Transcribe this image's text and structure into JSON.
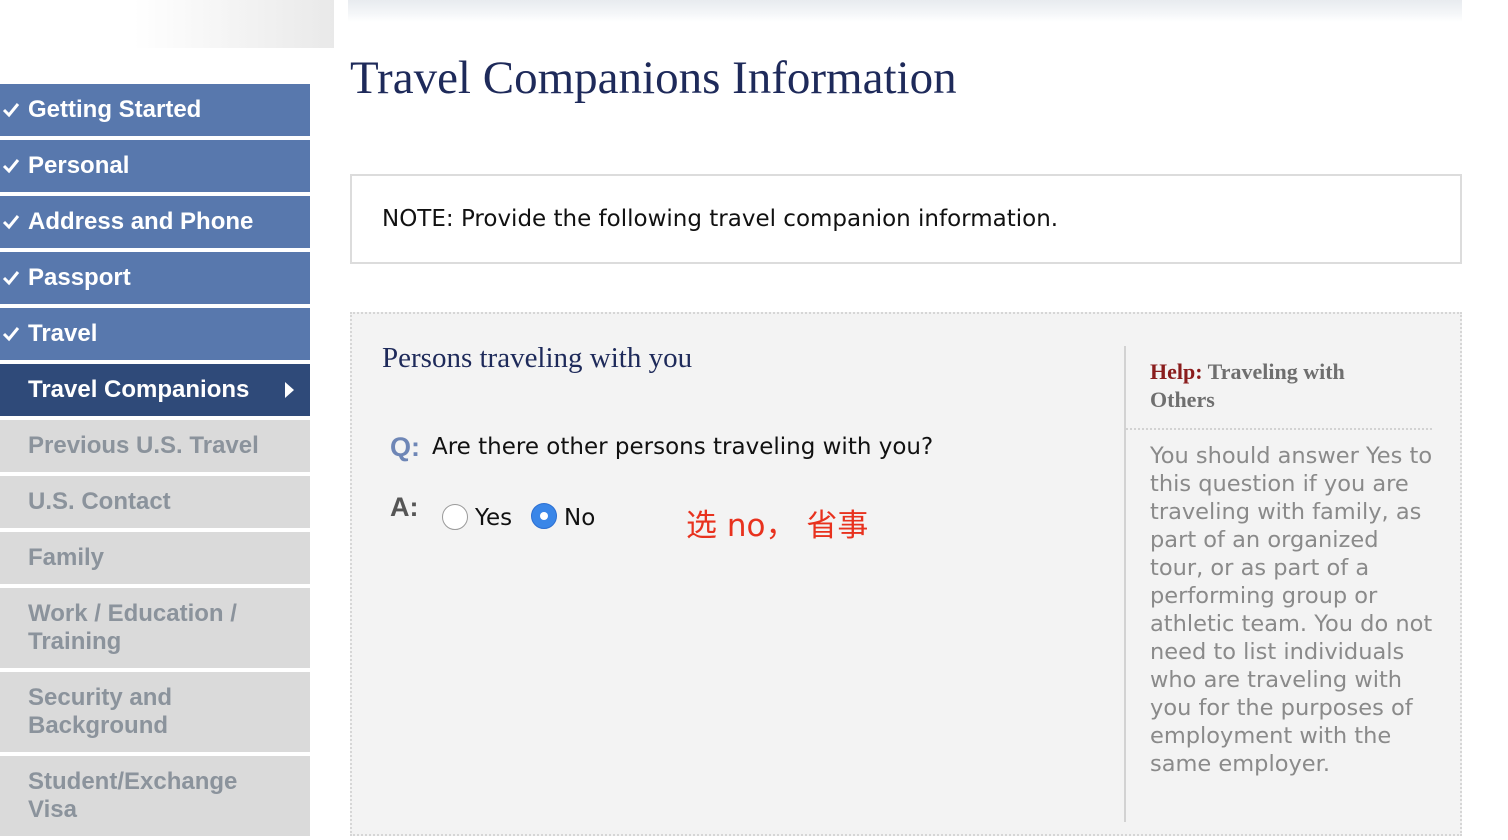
{
  "sidebar": {
    "items": [
      {
        "label": "Getting Started",
        "state": "done"
      },
      {
        "label": "Personal",
        "state": "done"
      },
      {
        "label": "Address and Phone",
        "state": "done"
      },
      {
        "label": "Passport",
        "state": "done"
      },
      {
        "label": "Travel",
        "state": "done"
      },
      {
        "label": "Travel Companions",
        "state": "active"
      },
      {
        "label": "Previous U.S. Travel",
        "state": "pending"
      },
      {
        "label": "U.S. Contact",
        "state": "pending"
      },
      {
        "label": "Family",
        "state": "pending"
      },
      {
        "label": "Work / Education / Training",
        "state": "pending"
      },
      {
        "label": "Security and Background",
        "state": "pending"
      },
      {
        "label": "Student/Exchange Visa",
        "state": "pending"
      }
    ]
  },
  "page": {
    "title": "Travel Companions Information",
    "note": "NOTE: Provide the following travel companion information."
  },
  "section": {
    "title": "Persons traveling with you",
    "question_label": "Q:",
    "question": "Are there other persons traveling with you?",
    "answer_label": "A:",
    "options": [
      {
        "label": "Yes",
        "selected": false
      },
      {
        "label": "No",
        "selected": true
      }
    ],
    "annotation": "选 no， 省事"
  },
  "help": {
    "prefix": "Help:",
    "title": "Traveling with Others",
    "body": "You should answer Yes to this question if you are traveling with family, as part of an organized tour, or as part of a performing group or athletic team. You do not need to list individuals who are traveling with you for the purposes of employment with the same employer."
  },
  "colors": {
    "nav_done": "#5878ad",
    "nav_active": "#2f4a79",
    "nav_pending": "#dadada",
    "title_navy": "#1e2a5a",
    "radio_selected": "#3a86e8",
    "annotation_red": "#e8321e",
    "help_prefix": "#8a1c1c"
  },
  "icons": {
    "completed": "check-icon",
    "current": "arrow-right-icon"
  }
}
